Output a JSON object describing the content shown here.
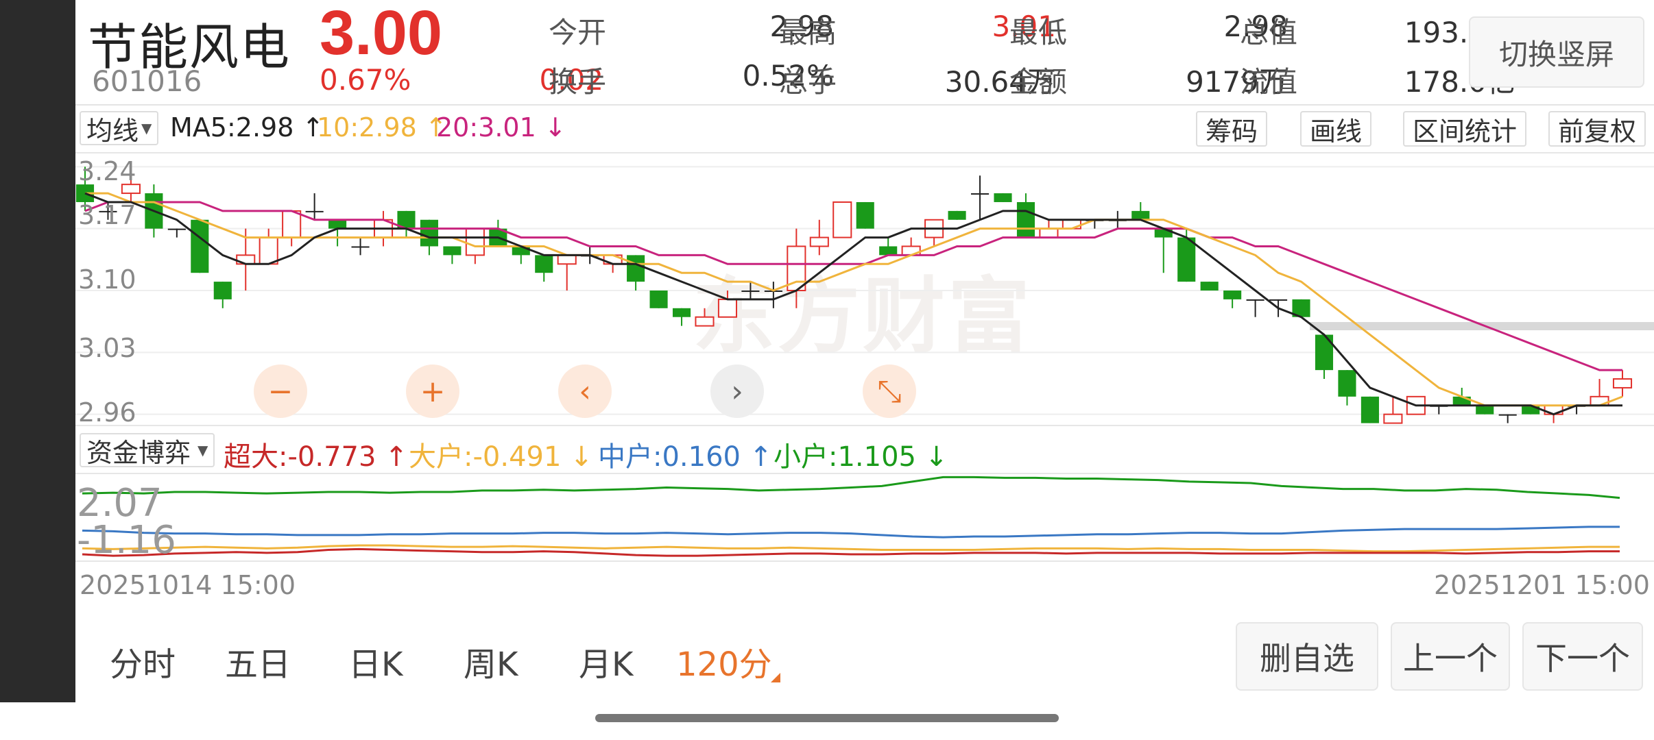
{
  "header": {
    "stock_name": "节能风电",
    "stock_code": "601016",
    "price": "3.00",
    "change_pct": "0.67%",
    "change_amt": "0.02",
    "quotes": [
      {
        "label": "今开",
        "value": "2.98",
        "color": "normal"
      },
      {
        "label": "最高",
        "value": "3.01",
        "color": "red"
      },
      {
        "label": "最低",
        "value": "2.98",
        "color": "normal"
      },
      {
        "label": "总值",
        "value": "193.2亿",
        "color": "normal"
      },
      {
        "label": "换手",
        "value": "0.52%",
        "color": "normal"
      },
      {
        "label": "总手",
        "value": "30.64万",
        "color": "normal"
      },
      {
        "label": "金额",
        "value": "9179万",
        "color": "normal"
      },
      {
        "label": "流值",
        "value": "178.0亿",
        "color": "normal"
      }
    ],
    "switch_label": "切换竖屏"
  },
  "ma_bar": {
    "select_label": "均线",
    "ma5": "MA5:2.98",
    "ma10": "10:2.98",
    "ma20": "20:3.01",
    "tools": [
      "筹码",
      "画线",
      "区间统计",
      "前复权"
    ]
  },
  "chart": {
    "y_labels": [
      "3.24",
      "3.17",
      "3.10",
      "3.03",
      "2.96"
    ],
    "watermark": "东方财富",
    "controls": [
      {
        "icon": "minus-icon",
        "glyph": "−"
      },
      {
        "icon": "plus-icon",
        "glyph": "+"
      },
      {
        "icon": "chevron-left-icon",
        "glyph": "‹"
      },
      {
        "icon": "chevron-right-icon",
        "glyph": "›"
      },
      {
        "icon": "collapse-icon",
        "glyph": "⤡"
      }
    ]
  },
  "fund_bar": {
    "select_label": "资金博弈",
    "super": "超大:-0.773",
    "big": "大户:-0.491",
    "mid": "中户:0.160",
    "small": "小户:1.105"
  },
  "fund_chart": {
    "y_top": "2.07",
    "y_bottom": "-1.16"
  },
  "dates": {
    "start": "20251014 15:00",
    "end": "20251201 15:00"
  },
  "periods": [
    "分时",
    "五日",
    "日K",
    "周K",
    "月K",
    "120分"
  ],
  "active_period": "120分",
  "buttons": {
    "remove_watch": "删自选",
    "prev": "上一个",
    "next": "下一个"
  },
  "colors": {
    "up": "#e2312c",
    "down": "#1a9a1a",
    "ma5": "#222222",
    "ma10": "#f0b43c",
    "ma20": "#c8237d",
    "accent": "#e8742c",
    "mid_line": "#3a78c4"
  },
  "chart_data": {
    "type": "candlestick",
    "y_ticks": [
      3.24,
      3.17,
      3.1,
      3.03,
      2.96
    ],
    "ylim": [
      2.945,
      3.255
    ],
    "candles": [
      {
        "o": 3.22,
        "c": 3.2,
        "h": 3.24,
        "l": 3.19
      },
      {
        "o": 3.19,
        "c": 3.19,
        "h": 3.2,
        "l": 3.18
      },
      {
        "o": 3.21,
        "c": 3.22,
        "h": 3.23,
        "l": 3.2
      },
      {
        "o": 3.21,
        "c": 3.17,
        "h": 3.22,
        "l": 3.16
      },
      {
        "o": 3.17,
        "c": 3.17,
        "h": 3.17,
        "l": 3.16
      },
      {
        "o": 3.18,
        "c": 3.12,
        "h": 3.18,
        "l": 3.12
      },
      {
        "o": 3.11,
        "c": 3.09,
        "h": 3.11,
        "l": 3.08
      },
      {
        "o": 3.13,
        "c": 3.14,
        "h": 3.17,
        "l": 3.1
      },
      {
        "o": 3.13,
        "c": 3.16,
        "h": 3.17,
        "l": 3.13
      },
      {
        "o": 3.16,
        "c": 3.19,
        "h": 3.19,
        "l": 3.15
      },
      {
        "o": 3.19,
        "c": 3.19,
        "h": 3.21,
        "l": 3.18
      },
      {
        "o": 3.18,
        "c": 3.17,
        "h": 3.18,
        "l": 3.15
      },
      {
        "o": 3.15,
        "c": 3.15,
        "h": 3.16,
        "l": 3.14
      },
      {
        "o": 3.16,
        "c": 3.18,
        "h": 3.19,
        "l": 3.15
      },
      {
        "o": 3.19,
        "c": 3.17,
        "h": 3.19,
        "l": 3.16
      },
      {
        "o": 3.18,
        "c": 3.15,
        "h": 3.18,
        "l": 3.14
      },
      {
        "o": 3.15,
        "c": 3.14,
        "h": 3.15,
        "l": 3.13
      },
      {
        "o": 3.14,
        "c": 3.17,
        "h": 3.17,
        "l": 3.13
      },
      {
        "o": 3.17,
        "c": 3.15,
        "h": 3.18,
        "l": 3.15
      },
      {
        "o": 3.15,
        "c": 3.14,
        "h": 3.15,
        "l": 3.13
      },
      {
        "o": 3.14,
        "c": 3.12,
        "h": 3.14,
        "l": 3.11
      },
      {
        "o": 3.13,
        "c": 3.14,
        "h": 3.14,
        "l": 3.1
      },
      {
        "o": 3.14,
        "c": 3.14,
        "h": 3.15,
        "l": 3.13
      },
      {
        "o": 3.13,
        "c": 3.14,
        "h": 3.14,
        "l": 3.12
      },
      {
        "o": 3.14,
        "c": 3.11,
        "h": 3.14,
        "l": 3.1
      },
      {
        "o": 3.1,
        "c": 3.08,
        "h": 3.1,
        "l": 3.08
      },
      {
        "o": 3.08,
        "c": 3.07,
        "h": 3.08,
        "l": 3.06
      },
      {
        "o": 3.06,
        "c": 3.07,
        "h": 3.08,
        "l": 3.06
      },
      {
        "o": 3.07,
        "c": 3.09,
        "h": 3.1,
        "l": 3.07
      },
      {
        "o": 3.1,
        "c": 3.1,
        "h": 3.11,
        "l": 3.09
      },
      {
        "o": 3.1,
        "c": 3.1,
        "h": 3.11,
        "l": 3.08
      },
      {
        "o": 3.1,
        "c": 3.15,
        "h": 3.17,
        "l": 3.08
      },
      {
        "o": 3.15,
        "c": 3.16,
        "h": 3.18,
        "l": 3.14
      },
      {
        "o": 3.16,
        "c": 3.2,
        "h": 3.2,
        "l": 3.16
      },
      {
        "o": 3.2,
        "c": 3.17,
        "h": 3.2,
        "l": 3.17
      },
      {
        "o": 3.15,
        "c": 3.14,
        "h": 3.16,
        "l": 3.14
      },
      {
        "o": 3.14,
        "c": 3.15,
        "h": 3.16,
        "l": 3.14
      },
      {
        "o": 3.16,
        "c": 3.18,
        "h": 3.18,
        "l": 3.15
      },
      {
        "o": 3.19,
        "c": 3.18,
        "h": 3.19,
        "l": 3.18
      },
      {
        "o": 3.21,
        "c": 3.21,
        "h": 3.23,
        "l": 3.18
      },
      {
        "o": 3.21,
        "c": 3.2,
        "h": 3.21,
        "l": 3.2
      },
      {
        "o": 3.2,
        "c": 3.16,
        "h": 3.21,
        "l": 3.16
      },
      {
        "o": 3.16,
        "c": 3.17,
        "h": 3.18,
        "l": 3.16
      },
      {
        "o": 3.17,
        "c": 3.18,
        "h": 3.18,
        "l": 3.17
      },
      {
        "o": 3.18,
        "c": 3.18,
        "h": 3.18,
        "l": 3.17
      },
      {
        "o": 3.18,
        "c": 3.18,
        "h": 3.19,
        "l": 3.17
      },
      {
        "o": 3.19,
        "c": 3.18,
        "h": 3.2,
        "l": 3.18
      },
      {
        "o": 3.17,
        "c": 3.16,
        "h": 3.17,
        "l": 3.12
      },
      {
        "o": 3.16,
        "c": 3.11,
        "h": 3.17,
        "l": 3.11
      },
      {
        "o": 3.11,
        "c": 3.1,
        "h": 3.11,
        "l": 3.1
      },
      {
        "o": 3.1,
        "c": 3.09,
        "h": 3.1,
        "l": 3.08
      },
      {
        "o": 3.09,
        "c": 3.09,
        "h": 3.09,
        "l": 3.07
      },
      {
        "o": 3.09,
        "c": 3.09,
        "h": 3.09,
        "l": 3.07
      },
      {
        "o": 3.09,
        "c": 3.07,
        "h": 3.09,
        "l": 3.07
      },
      {
        "o": 3.05,
        "c": 3.01,
        "h": 3.05,
        "l": 3.0
      },
      {
        "o": 3.01,
        "c": 2.98,
        "h": 3.01,
        "l": 2.97
      },
      {
        "o": 2.98,
        "c": 2.95,
        "h": 2.98,
        "l": 2.95
      },
      {
        "o": 2.95,
        "c": 2.96,
        "h": 2.98,
        "l": 2.95
      },
      {
        "o": 2.96,
        "c": 2.98,
        "h": 2.98,
        "l": 2.96
      },
      {
        "o": 2.97,
        "c": 2.97,
        "h": 2.97,
        "l": 2.96
      },
      {
        "o": 2.98,
        "c": 2.97,
        "h": 2.99,
        "l": 2.97
      },
      {
        "o": 2.97,
        "c": 2.96,
        "h": 2.97,
        "l": 2.96
      },
      {
        "o": 2.96,
        "c": 2.96,
        "h": 2.96,
        "l": 2.95
      },
      {
        "o": 2.97,
        "c": 2.96,
        "h": 2.97,
        "l": 2.96
      },
      {
        "o": 2.96,
        "c": 2.97,
        "h": 2.97,
        "l": 2.95
      },
      {
        "o": 2.97,
        "c": 2.97,
        "h": 2.97,
        "l": 2.96
      },
      {
        "o": 2.97,
        "c": 2.98,
        "h": 3.0,
        "l": 2.97
      },
      {
        "o": 2.99,
        "c": 3.0,
        "h": 3.01,
        "l": 2.98
      }
    ],
    "ma5": [
      3.21,
      3.2,
      3.2,
      3.19,
      3.18,
      3.16,
      3.14,
      3.13,
      3.13,
      3.14,
      3.16,
      3.17,
      3.17,
      3.17,
      3.17,
      3.16,
      3.16,
      3.16,
      3.16,
      3.15,
      3.14,
      3.14,
      3.14,
      3.13,
      3.13,
      3.12,
      3.11,
      3.1,
      3.09,
      3.09,
      3.09,
      3.1,
      3.12,
      3.14,
      3.16,
      3.16,
      3.17,
      3.17,
      3.17,
      3.18,
      3.19,
      3.19,
      3.18,
      3.18,
      3.18,
      3.18,
      3.18,
      3.17,
      3.16,
      3.14,
      3.12,
      3.1,
      3.08,
      3.07,
      3.05,
      3.02,
      2.99,
      2.98,
      2.97,
      2.97,
      2.97,
      2.97,
      2.97,
      2.97,
      2.96,
      2.97,
      2.97,
      2.97
    ],
    "ma10": [
      3.21,
      3.21,
      3.2,
      3.2,
      3.19,
      3.18,
      3.17,
      3.16,
      3.16,
      3.16,
      3.16,
      3.16,
      3.16,
      3.16,
      3.16,
      3.16,
      3.16,
      3.15,
      3.15,
      3.15,
      3.15,
      3.14,
      3.14,
      3.14,
      3.13,
      3.13,
      3.12,
      3.12,
      3.11,
      3.11,
      3.1,
      3.11,
      3.11,
      3.12,
      3.13,
      3.13,
      3.14,
      3.15,
      3.16,
      3.17,
      3.17,
      3.17,
      3.17,
      3.17,
      3.18,
      3.18,
      3.18,
      3.18,
      3.17,
      3.16,
      3.15,
      3.14,
      3.12,
      3.11,
      3.09,
      3.07,
      3.05,
      3.03,
      3.01,
      2.99,
      2.98,
      2.97,
      2.97,
      2.97,
      2.97,
      2.97,
      2.97,
      2.98
    ],
    "ma20": [
      3.19,
      3.2,
      3.2,
      3.2,
      3.2,
      3.2,
      3.19,
      3.19,
      3.19,
      3.19,
      3.18,
      3.18,
      3.18,
      3.18,
      3.17,
      3.17,
      3.17,
      3.17,
      3.17,
      3.16,
      3.16,
      3.16,
      3.15,
      3.15,
      3.15,
      3.14,
      3.14,
      3.14,
      3.13,
      3.13,
      3.13,
      3.13,
      3.13,
      3.13,
      3.13,
      3.14,
      3.14,
      3.14,
      3.15,
      3.15,
      3.16,
      3.16,
      3.16,
      3.16,
      3.16,
      3.17,
      3.17,
      3.17,
      3.17,
      3.16,
      3.16,
      3.15,
      3.15,
      3.14,
      3.13,
      3.12,
      3.11,
      3.1,
      3.09,
      3.08,
      3.07,
      3.06,
      3.05,
      3.04,
      3.03,
      3.02,
      3.01,
      3.01
    ],
    "fund": {
      "ylim": [
        -2.5,
        3.5
      ],
      "small": [
        2.2,
        2.25,
        2.2,
        2.3,
        2.3,
        2.25,
        2.2,
        2.25,
        2.3,
        2.3,
        2.25,
        2.3,
        2.3,
        2.4,
        2.4,
        2.45,
        2.4,
        2.45,
        2.5,
        2.6,
        2.55,
        2.5,
        2.4,
        2.45,
        2.5,
        2.6,
        2.7,
        3.0,
        3.3,
        3.3,
        3.25,
        3.25,
        3.2,
        3.2,
        3.15,
        3.1,
        3.0,
        2.95,
        2.9,
        2.7,
        2.6,
        2.5,
        2.5,
        2.4,
        2.4,
        2.5,
        2.45,
        2.3,
        2.2,
        2.1,
        1.9
      ],
      "mid": [
        -0.3,
        -0.35,
        -0.45,
        -0.5,
        -0.5,
        -0.55,
        -0.55,
        -0.6,
        -0.6,
        -0.6,
        -0.55,
        -0.55,
        -0.5,
        -0.5,
        -0.5,
        -0.45,
        -0.45,
        -0.5,
        -0.5,
        -0.45,
        -0.5,
        -0.55,
        -0.5,
        -0.45,
        -0.45,
        -0.5,
        -0.6,
        -0.7,
        -0.75,
        -0.7,
        -0.7,
        -0.65,
        -0.6,
        -0.55,
        -0.55,
        -0.5,
        -0.45,
        -0.45,
        -0.5,
        -0.5,
        -0.4,
        -0.3,
        -0.25,
        -0.2,
        -0.2,
        -0.2,
        -0.2,
        -0.15,
        -0.1,
        -0.05,
        -0.05
      ],
      "big": [
        -1.5,
        -1.55,
        -1.5,
        -1.45,
        -1.4,
        -1.45,
        -1.5,
        -1.45,
        -1.35,
        -1.3,
        -1.3,
        -1.35,
        -1.4,
        -1.4,
        -1.35,
        -1.4,
        -1.45,
        -1.5,
        -1.45,
        -1.4,
        -1.45,
        -1.5,
        -1.5,
        -1.45,
        -1.5,
        -1.55,
        -1.6,
        -1.6,
        -1.6,
        -1.6,
        -1.55,
        -1.5,
        -1.5,
        -1.5,
        -1.55,
        -1.5,
        -1.55,
        -1.55,
        -1.6,
        -1.6,
        -1.6,
        -1.65,
        -1.7,
        -1.7,
        -1.65,
        -1.6,
        -1.55,
        -1.5,
        -1.45,
        -1.4,
        -1.4
      ],
      "super": [
        -1.9,
        -2.0,
        -1.95,
        -1.85,
        -1.8,
        -1.75,
        -1.8,
        -1.75,
        -1.6,
        -1.55,
        -1.6,
        -1.65,
        -1.7,
        -1.75,
        -1.75,
        -1.7,
        -1.75,
        -1.85,
        -1.95,
        -2.0,
        -2.0,
        -1.95,
        -1.9,
        -1.85,
        -1.85,
        -1.9,
        -1.9,
        -1.85,
        -1.85,
        -1.8,
        -1.8,
        -1.8,
        -1.85,
        -1.8,
        -1.8,
        -1.8,
        -1.8,
        -1.85,
        -1.85,
        -1.85,
        -1.8,
        -1.8,
        -1.8,
        -1.8,
        -1.8,
        -1.85,
        -1.8,
        -1.75,
        -1.75,
        -1.7,
        -1.7
      ]
    }
  }
}
